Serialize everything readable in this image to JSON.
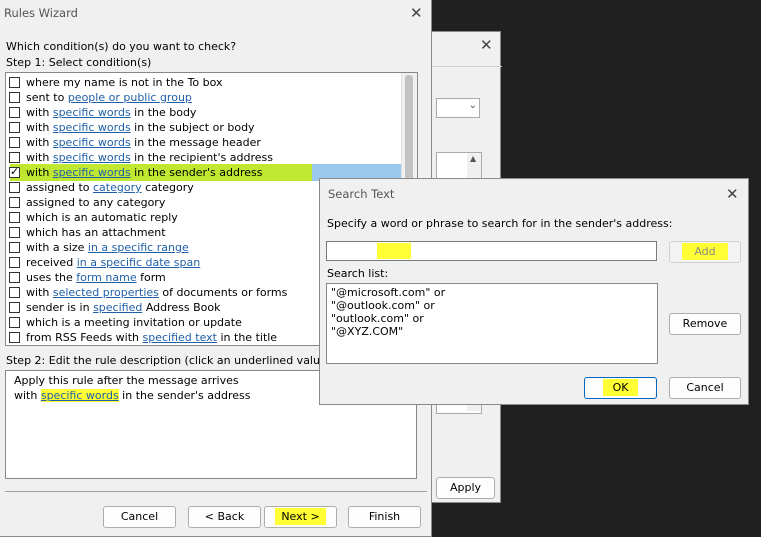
{
  "back_dialog": {
    "apply_label": "Apply"
  },
  "rules_wizard": {
    "title": "Rules Wizard",
    "question": "Which condition(s) do you want to check?",
    "step1": "Step 1: Select condition(s)",
    "conditions": [
      {
        "pre": "where my name is not in the To box",
        "link": "",
        "post": "",
        "checked": false
      },
      {
        "pre": "sent to ",
        "link": "people or public group",
        "post": "",
        "checked": false
      },
      {
        "pre": "with ",
        "link": "specific words",
        "post": " in the body",
        "checked": false
      },
      {
        "pre": "with ",
        "link": "specific words",
        "post": " in the subject or body",
        "checked": false
      },
      {
        "pre": "with ",
        "link": "specific words",
        "post": " in the message header",
        "checked": false
      },
      {
        "pre": "with ",
        "link": "specific words",
        "post": " in the recipient's address",
        "checked": false
      },
      {
        "pre": "with ",
        "link": "specific words",
        "post": " in the sender's address",
        "checked": true
      },
      {
        "pre": "assigned to ",
        "link": "category",
        "post": " category",
        "checked": false
      },
      {
        "pre": "assigned to any category",
        "link": "",
        "post": "",
        "checked": false
      },
      {
        "pre": "which is an automatic reply",
        "link": "",
        "post": "",
        "checked": false
      },
      {
        "pre": "which has an attachment",
        "link": "",
        "post": "",
        "checked": false
      },
      {
        "pre": "with a size ",
        "link": "in a specific range",
        "post": "",
        "checked": false
      },
      {
        "pre": "received ",
        "link": "in a specific date span",
        "post": "",
        "checked": false
      },
      {
        "pre": "uses the ",
        "link": "form name",
        "post": " form",
        "checked": false
      },
      {
        "pre": "with ",
        "link": "selected properties",
        "post": " of documents or forms",
        "checked": false
      },
      {
        "pre": "sender is in ",
        "link": "specified",
        "post": " Address Book",
        "checked": false
      },
      {
        "pre": "which is a meeting invitation or update",
        "link": "",
        "post": "",
        "checked": false
      },
      {
        "pre": "from RSS Feeds with ",
        "link": "specified text",
        "post": " in the title",
        "checked": false
      }
    ],
    "step2": "Step 2: Edit the rule description (click an underlined value)",
    "desc_line1": "Apply this rule after the message arrives",
    "desc_line2_pre": "with ",
    "desc_line2_link": "specific words",
    "desc_line2_post": " in the sender's address",
    "buttons": {
      "cancel": "Cancel",
      "back": "< Back",
      "next": "Next >",
      "finish": "Finish"
    }
  },
  "search_text": {
    "title": "Search Text",
    "prompt": "Specify a word or phrase to search for in the sender's address:",
    "input_value": "",
    "add_label": "Add",
    "search_list_label": "Search list:",
    "search_list": [
      "\"@microsoft.com\" or",
      "\"@outlook.com\" or",
      "\"outlook.com\" or",
      "\"@XYZ.COM\""
    ],
    "remove_label": "Remove",
    "ok_label": "OK",
    "cancel_label": "Cancel"
  },
  "colors": {
    "highlight_yellow": "#ffff33",
    "highlight_green": "#c1e830",
    "link_blue": "#1f5fa8",
    "selection_blue": "#99c9ef"
  }
}
